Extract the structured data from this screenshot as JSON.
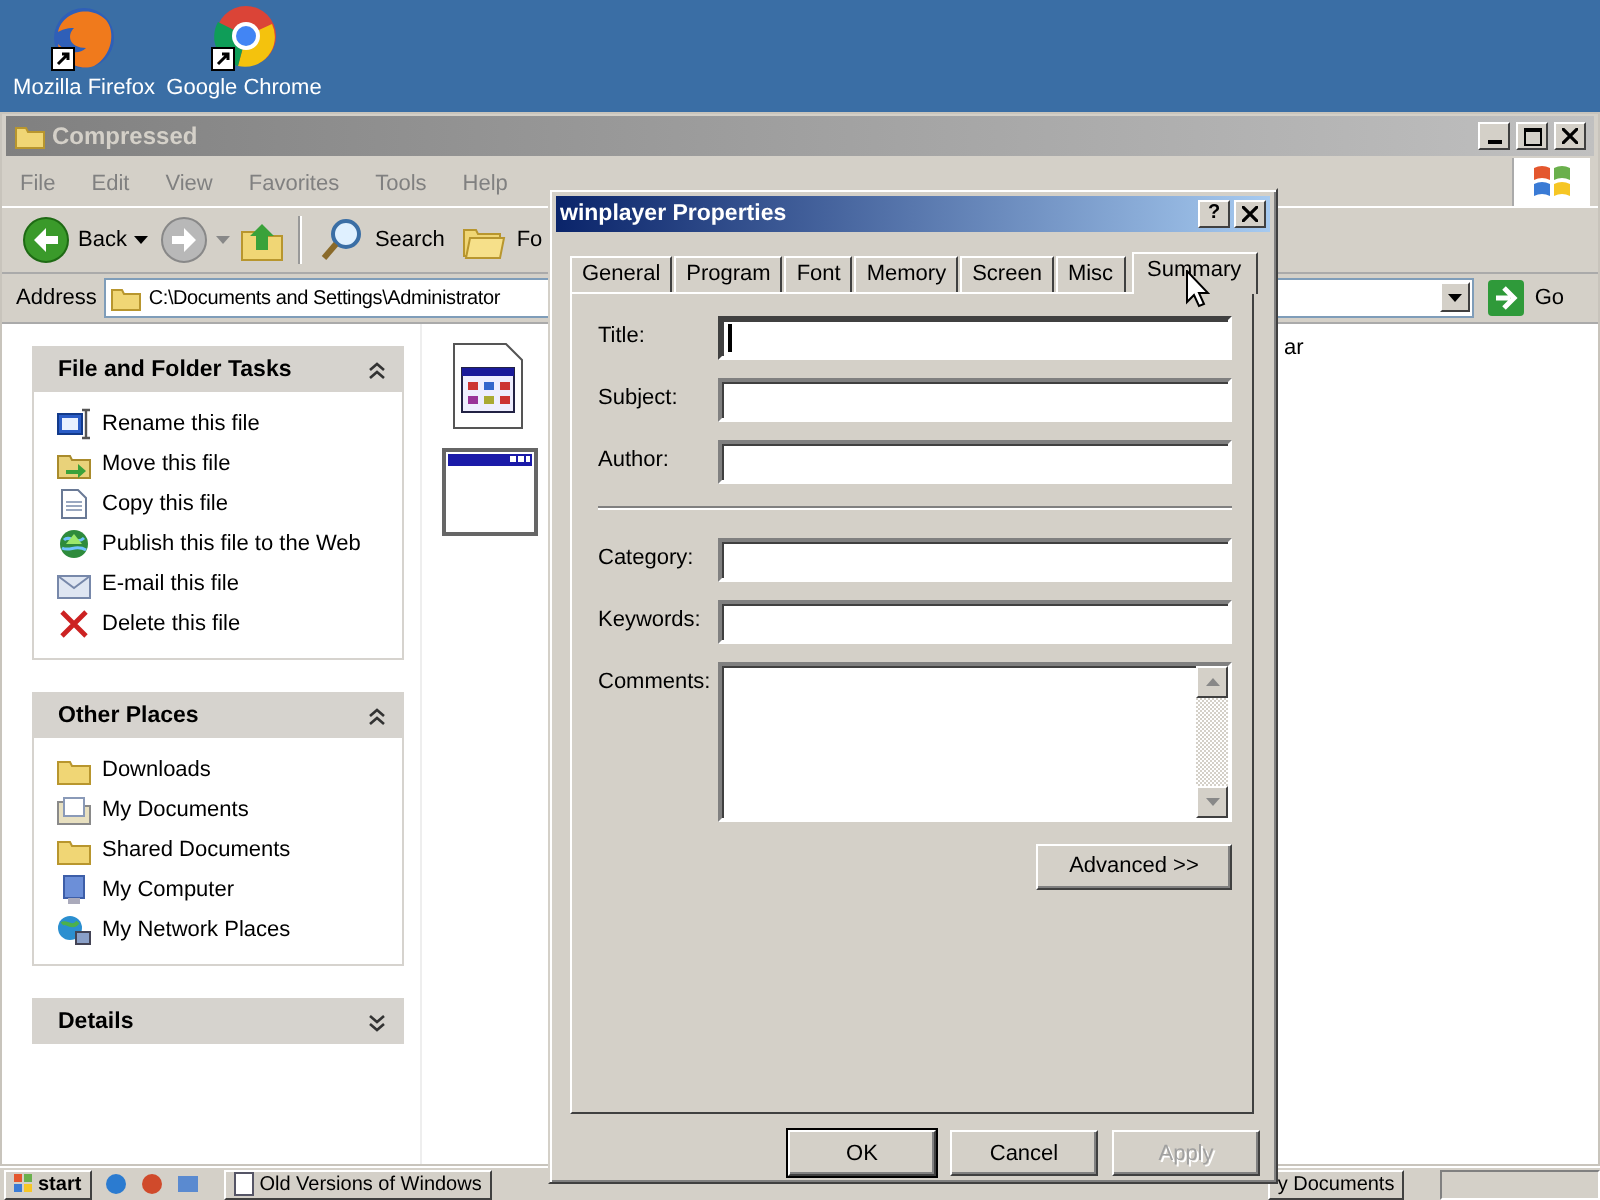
{
  "desktop": {
    "icons": [
      {
        "label": "Mozilla Firefox",
        "kind": "fox"
      },
      {
        "label": "Google Chrome",
        "kind": "wheel"
      }
    ]
  },
  "explorer": {
    "title": "Compressed",
    "active": false,
    "menu": [
      "File",
      "Edit",
      "View",
      "Favorites",
      "Tools",
      "Help"
    ],
    "toolbar": {
      "back": "Back",
      "search": "Search",
      "folders": "Fo"
    },
    "address": {
      "label": "Address",
      "value": "C:\\Documents and Settings\\Administrator",
      "go": "Go"
    },
    "task_panels": [
      {
        "title": "File and Folder Tasks",
        "expanded": true,
        "items": [
          "Rename this file",
          "Move this file",
          "Copy this file",
          "Publish this file to the Web",
          "E-mail this file",
          "Delete this file"
        ]
      },
      {
        "title": "Other Places",
        "expanded": true,
        "items": [
          "Downloads",
          "My Documents",
          "Shared Documents",
          "My Computer",
          "My Network Places"
        ]
      },
      {
        "title": "Details",
        "expanded": false
      }
    ],
    "files": [
      {
        "kind": "program"
      },
      {
        "kind": "window"
      }
    ],
    "file_label_fragment": "ar"
  },
  "dialog": {
    "title": "winplayer Properties",
    "help": "?",
    "tabs": [
      {
        "label": "General",
        "selected": false
      },
      {
        "label": "Program",
        "selected": false
      },
      {
        "label": "Font",
        "selected": false
      },
      {
        "label": "Memory",
        "selected": false
      },
      {
        "label": "Screen",
        "selected": false
      },
      {
        "label": "Misc",
        "selected": false
      },
      {
        "label": "Summary",
        "selected": true
      }
    ],
    "fields": [
      {
        "label": "Title:",
        "kind": "line",
        "focused": true
      },
      {
        "label": "Subject:",
        "kind": "line",
        "focused": false
      },
      {
        "label": "Author:",
        "kind": "line",
        "focused": false
      },
      {
        "kind": "separator"
      },
      {
        "label": "Category:",
        "kind": "line",
        "focused": false
      },
      {
        "label": "Keywords:",
        "kind": "line",
        "focused": false
      },
      {
        "label": "Comments:",
        "kind": "multiline",
        "focused": false
      }
    ],
    "advanced": "Advanced >>",
    "buttons": [
      {
        "label": "OK",
        "disabled": false,
        "default": true
      },
      {
        "label": "Cancel",
        "disabled": false,
        "default": false
      },
      {
        "label": "Apply",
        "disabled": true,
        "default": false
      }
    ]
  },
  "taskbar": {
    "start": "start",
    "items": [
      "Old Versions of Windows",
      "y Documents"
    ]
  }
}
